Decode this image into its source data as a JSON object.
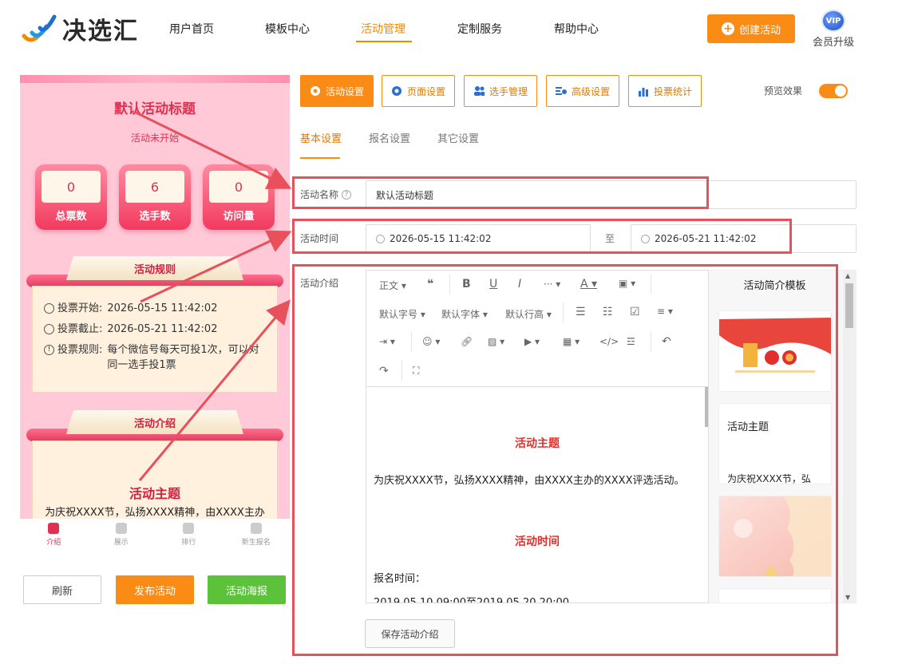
{
  "header": {
    "brand": "决选汇",
    "nav": [
      "用户首页",
      "模板中心",
      "活动管理",
      "定制服务",
      "帮助中心"
    ],
    "create_label": "创建活动",
    "vip_badge": "VIP",
    "vip_label": "会员升级",
    "accent": "#fa8c16"
  },
  "preview": {
    "title": "默认活动标题",
    "status": "活动未开始",
    "stats": [
      {
        "value": "0",
        "label": "总票数"
      },
      {
        "value": "6",
        "label": "选手数"
      },
      {
        "value": "0",
        "label": "访问量"
      }
    ],
    "rules_title": "活动规则",
    "rules": [
      {
        "label": "投票开始:",
        "value": "2026-05-15 11:42:02"
      },
      {
        "label": "投票截止:",
        "value": "2026-05-21 11:42:02"
      },
      {
        "label": "投票规则:",
        "value": "每个微信号每天可投1次，可以对同一选手投1票"
      }
    ],
    "intro_title": "活动介绍",
    "intro_heading": "活动主题",
    "intro_text": "为庆祝XXXX节，弘扬XXXX精神，由XXXX主办",
    "tabs": [
      "介绍",
      "展示",
      "排行",
      "新生报名"
    ]
  },
  "left_buttons": {
    "refresh": "刷新",
    "publish": "发布活动",
    "poster": "活动海报"
  },
  "toolbar_tabs": [
    "活动设置",
    "页面设置",
    "选手管理",
    "高级设置",
    "投票统计"
  ],
  "preview_toggle_label": "预览效果",
  "sub_tabs": [
    "基本设置",
    "报名设置",
    "其它设置"
  ],
  "form": {
    "name_label": "活动名称",
    "name_value": "默认活动标题",
    "time_label": "活动时间",
    "start": "2026-05-15 11:42:02",
    "to": "至",
    "end": "2026-05-21 11:42:02",
    "intro_label": "活动介绍"
  },
  "editor_toolbar": {
    "paragraph": "正文",
    "font_size": "默认字号",
    "font_family": "默认字体",
    "line_height": "默认行高"
  },
  "editor_content": {
    "heading1": "活动主题",
    "para1": "为庆祝XXXX节，弘扬XXXX精神，由XXXX主办的XXXX评选活动。",
    "heading2": "活动时间",
    "para2": "报名时间：",
    "para3": "2019.05.10 09:00至2019.05.20 20:00"
  },
  "templates": {
    "title": "活动简介模板",
    "card2_heading": "活动主题",
    "card2_text": "为庆祝XXXX节，弘"
  },
  "save_button": "保存活动介绍"
}
